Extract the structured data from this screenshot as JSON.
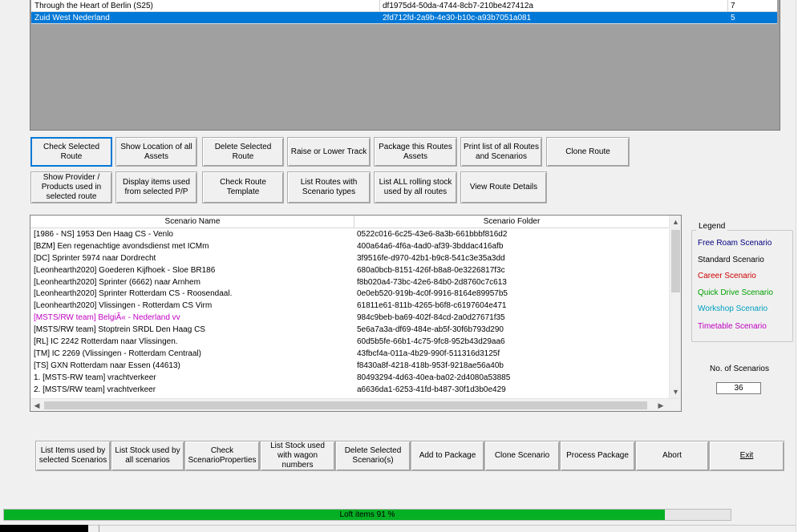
{
  "routes": {
    "rows": [
      {
        "name": "Through the Heart of Berlin (S25)",
        "id": "df1975d4-50da-4744-8cb7-210be427412a",
        "count": "7",
        "selected": false
      },
      {
        "name": "Zuid West Nederland",
        "id": "2fd712fd-2a9b-4e30-b10c-a93b7051a081",
        "count": "5",
        "selected": true
      }
    ]
  },
  "route_buttons": {
    "check_selected": "Check Selected\nRoute",
    "show_location": "Show Location of all\nAssets",
    "delete_selected": "Delete Selected\nRoute",
    "raise_lower": "Raise or Lower Track",
    "package_assets": "Package this Routes\nAssets",
    "print_list": "Print list of all Routes\nand Scenarios",
    "clone_route": "Clone Route",
    "show_provider": "Show Provider /\nProducts used in\nselected route",
    "display_items": "Display items used\nfrom selected P/P",
    "check_template": "Check Route\nTemplate",
    "list_routes_types": "List Routes with\nScenario types",
    "list_all_stock": "List ALL rolling stock\nused by all routes",
    "view_details": "View Route Details"
  },
  "scenarios": {
    "col_name": "Scenario Name",
    "col_folder": "Scenario Folder",
    "rows": [
      {
        "name": "[1986 - NS] 1953 Den Haag CS - Venlo",
        "folder": "0522c016-6c25-43e6-8a3b-661bbbf816d2",
        "color": "#000000"
      },
      {
        "name": "[BZM] Een regenachtige avondsdienst met ICMm",
        "folder": "400a64a6-4f6a-4ad0-af39-3bddac416afb",
        "color": "#000000"
      },
      {
        "name": "[DC] Sprinter 5974 naar Dordrecht",
        "folder": "3f9516fe-d970-42b1-b9c8-541c3e35a3dd",
        "color": "#000000"
      },
      {
        "name": "[Leonhearth2020] Goederen Kijfhoek - Sloe BR186",
        "folder": "680a0bcb-8151-426f-b8a8-0e3226817f3c",
        "color": "#000000"
      },
      {
        "name": "[Leonhearth2020] Sprinter (6662) naar Arnhem",
        "folder": "f8b020a4-73bc-42e6-84b0-2d8760c7c613",
        "color": "#000000"
      },
      {
        "name": "[Leonhearth2020] Sprinter Rotterdam CS - Roosendaal.",
        "folder": "0e0eb520-919b-4c0f-9916-8164e89957b5",
        "color": "#000000"
      },
      {
        "name": "[Leonhearth2020] Vlissingen - Rotterdam CS Virm",
        "folder": "61811e61-811b-4265-b6f8-c6197604e471",
        "color": "#000000"
      },
      {
        "name": "[MSTS/RW team]  BelgiÃ« - Nederland vv",
        "folder": "984c9beb-ba69-402f-84cd-2a0d27671f35",
        "color": "#c000c0"
      },
      {
        "name": "[MSTS/RW team] Stoptrein SRDL Den Haag CS",
        "folder": "5e6a7a3a-df69-484e-ab5f-30f6b793d290",
        "color": "#000000"
      },
      {
        "name": "[RL] IC 2242 Rotterdam naar Vlissingen.",
        "folder": "60d5b5fe-66b1-4c75-9fc8-952b43d29aa6",
        "color": "#000000"
      },
      {
        "name": "[TM] IC 2269 (Vlissingen - Rotterdam Centraal)",
        "folder": "43fbcf4a-011a-4b29-990f-511316d3125f",
        "color": "#000000"
      },
      {
        "name": "[TS] GXN Rotterdam naar Essen (44613)",
        "folder": "f8430a8f-4218-418b-953f-9218ae56a40b",
        "color": "#000000"
      },
      {
        "name": "1. [MSTS-RW team] vrachtverkeer",
        "folder": "80493294-4d63-40ea-ba02-2d4080a53885",
        "color": "#000000"
      },
      {
        "name": "2. [MSTS/RW team] vrachtverkeer",
        "folder": "a6636da1-6253-41fd-b487-30f1d3b0e429",
        "color": "#000000"
      }
    ]
  },
  "legend": {
    "title": "Legend",
    "items": [
      {
        "label": "Free Roam Scenario",
        "color": "#000080"
      },
      {
        "label": "Standard Scenario",
        "color": "#000000"
      },
      {
        "label": "Career Scenario",
        "color": "#d00000"
      },
      {
        "label": "Quick Drive Scenario",
        "color": "#00a000"
      },
      {
        "label": "Workshop Scenario",
        "color": "#00a0c0"
      },
      {
        "label": "Timetable Scenario",
        "color": "#c000c0"
      }
    ]
  },
  "no_scenarios": {
    "label": "No. of Scenarios",
    "value": "36"
  },
  "bottom_buttons": {
    "list_items": "List Items used by\nselected Scenarios",
    "list_stock": "List Stock used by\nall scenarios",
    "check_props": "Check\nScenarioProperties",
    "list_stock_wagon": "List Stock used\nwith wagon\nnumbers",
    "delete_scen": "Delete Selected\nScenario(s)",
    "add_package": "Add to Package",
    "clone_scen": "Clone Scenario",
    "process_package": "Process Package",
    "abort": "Abort",
    "exit": "Exit"
  },
  "progress": {
    "text": "Loft items 91 %",
    "fraction": 0.91,
    "color": "#06b025"
  },
  "icons": {
    "up": "▲",
    "down": "▼",
    "left": "◀",
    "right": "▶"
  }
}
